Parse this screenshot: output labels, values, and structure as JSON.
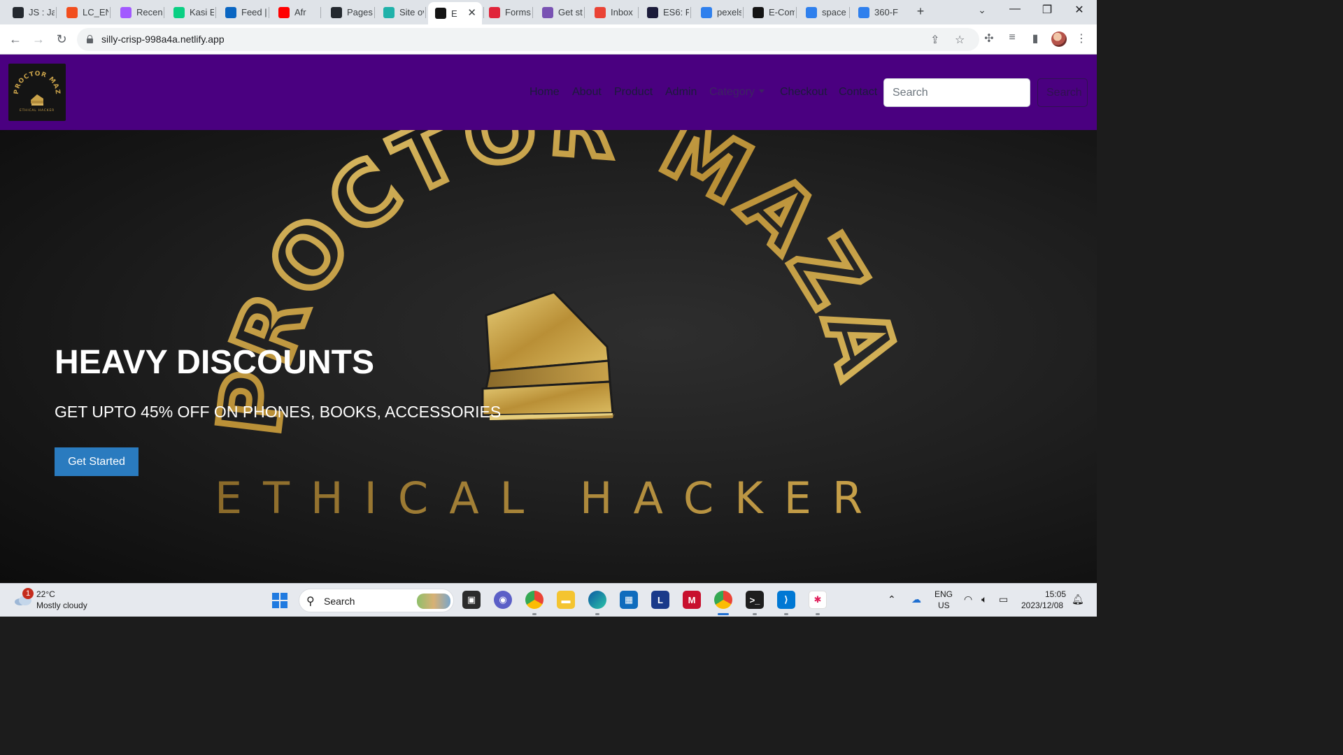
{
  "browser": {
    "tabs": [
      {
        "title": "JS : Ja",
        "icon": "github-icon",
        "color": "#24292f"
      },
      {
        "title": "LC_EN",
        "icon": "figma-icon",
        "color": "#f24e1e"
      },
      {
        "title": "Recent",
        "icon": "figma-icon",
        "color": "#a259ff"
      },
      {
        "title": "Kasi Ec",
        "icon": "figma-icon",
        "color": "#0acf83"
      },
      {
        "title": "Feed |",
        "icon": "linkedin-icon",
        "color": "#0a66c2"
      },
      {
        "title": "Afr",
        "icon": "youtube-icon",
        "color": "#ff0000"
      },
      {
        "title": "Pages",
        "icon": "github-icon",
        "color": "#24292f"
      },
      {
        "title": "Site ov",
        "icon": "netlify-icon",
        "color": "#20b2aa"
      },
      {
        "title": "E",
        "icon": "site-icon",
        "color": "#141414",
        "active": true
      },
      {
        "title": "Forms",
        "icon": "forms-icon",
        "color": "#e0243a"
      },
      {
        "title": "Get st",
        "icon": "bootstrap-icon",
        "color": "#7952b3"
      },
      {
        "title": "Inbox",
        "icon": "gmail-icon",
        "color": "#ea4335"
      },
      {
        "title": "ES6: P",
        "icon": "code-icon",
        "color": "#1b1b3a"
      },
      {
        "title": "pexels",
        "icon": "pexels-icon",
        "color": "#2f80ed"
      },
      {
        "title": "E-Com",
        "icon": "site-icon",
        "color": "#141414"
      },
      {
        "title": "space",
        "icon": "pexels-icon",
        "color": "#2f80ed"
      },
      {
        "title": "360-F",
        "icon": "pexels-icon",
        "color": "#2f80ed"
      }
    ],
    "url": "silly-crisp-998a4a.netlify.app"
  },
  "site": {
    "logo_label": "PROCTOR MAZA ETHICAL HACKER",
    "nav": {
      "home": "Home",
      "about": "About",
      "product": "Product",
      "admin": "Admin",
      "category": "Category",
      "checkout": "Checkout",
      "contact": "Contact"
    },
    "search": {
      "placeholder": "Search",
      "button_label": "Search"
    }
  },
  "hero": {
    "title": "HEAVY DISCOUNTS",
    "subtitle": "GET UPTO 45% OFF ON PHONES, BOOKS, ACCESSORIES",
    "cta_label": "Get Started",
    "art_arc_text": "PROCTOR MAZA",
    "art_bottom_text": "ETHICAL HACKER"
  },
  "taskbar": {
    "weather_temp": "22°C",
    "weather_desc": "Mostly cloudy",
    "weather_badge": "1",
    "search_label": "Search",
    "lang_line1": "ENG",
    "lang_line2": "US",
    "time": "15:05",
    "date": "2023/12/08"
  },
  "colors": {
    "navbar_bg": "#4a0080",
    "cta_bg": "#2a7bbf",
    "gold": "#c9a24a"
  }
}
